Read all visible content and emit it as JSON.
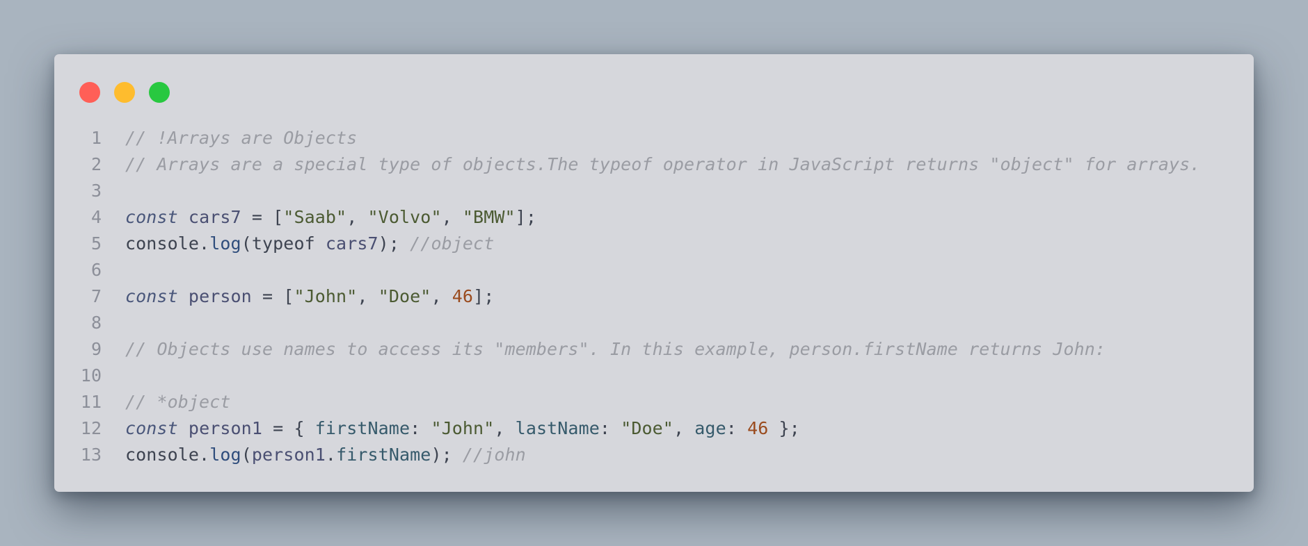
{
  "window": {
    "controls": [
      {
        "name": "close",
        "color": "#ff5f57"
      },
      {
        "name": "minimize",
        "color": "#febc2e"
      },
      {
        "name": "maximize",
        "color": "#28c840"
      }
    ]
  },
  "colors": {
    "background": "#a9b4bf",
    "window": "#d6d7dc",
    "comment": "#9a9ca3",
    "keyword": "#49567a",
    "string": "#4b5a32",
    "number": "#9a4b1e"
  },
  "editor": {
    "lines": [
      {
        "number": "1",
        "tokens": [
          {
            "t": "comment",
            "v": "// !Arrays are Objects"
          }
        ]
      },
      {
        "number": "2",
        "tokens": [
          {
            "t": "comment",
            "v": "// Arrays are a special type of objects.The typeof operator in JavaScript returns \"object\" for arrays."
          }
        ]
      },
      {
        "number": "3",
        "tokens": []
      },
      {
        "number": "4",
        "tokens": [
          {
            "t": "keyword",
            "v": "const"
          },
          {
            "t": "plain",
            "v": " "
          },
          {
            "t": "var",
            "v": "cars7"
          },
          {
            "t": "plain",
            "v": " = ["
          },
          {
            "t": "string",
            "v": "\"Saab\""
          },
          {
            "t": "plain",
            "v": ", "
          },
          {
            "t": "string",
            "v": "\"Volvo\""
          },
          {
            "t": "plain",
            "v": ", "
          },
          {
            "t": "string",
            "v": "\"BMW\""
          },
          {
            "t": "plain",
            "v": "];"
          }
        ]
      },
      {
        "number": "5",
        "tokens": [
          {
            "t": "plain",
            "v": "console."
          },
          {
            "t": "func",
            "v": "log"
          },
          {
            "t": "plain",
            "v": "(typeof "
          },
          {
            "t": "var",
            "v": "cars7"
          },
          {
            "t": "plain",
            "v": "); "
          },
          {
            "t": "comment",
            "v": "//object"
          }
        ]
      },
      {
        "number": "6",
        "tokens": []
      },
      {
        "number": "7",
        "tokens": [
          {
            "t": "keyword",
            "v": "const"
          },
          {
            "t": "plain",
            "v": " "
          },
          {
            "t": "var",
            "v": "person"
          },
          {
            "t": "plain",
            "v": " = ["
          },
          {
            "t": "string",
            "v": "\"John\""
          },
          {
            "t": "plain",
            "v": ", "
          },
          {
            "t": "string",
            "v": "\"Doe\""
          },
          {
            "t": "plain",
            "v": ", "
          },
          {
            "t": "number",
            "v": "46"
          },
          {
            "t": "plain",
            "v": "];"
          }
        ]
      },
      {
        "number": "8",
        "tokens": []
      },
      {
        "number": "9",
        "tokens": [
          {
            "t": "comment",
            "v": "// Objects use names to access its \"members\". In this example, person.firstName returns John:"
          }
        ]
      },
      {
        "number": "10",
        "tokens": []
      },
      {
        "number": "11",
        "tokens": [
          {
            "t": "comment",
            "v": "// *object"
          }
        ]
      },
      {
        "number": "12",
        "tokens": [
          {
            "t": "keyword",
            "v": "const"
          },
          {
            "t": "plain",
            "v": " "
          },
          {
            "t": "var",
            "v": "person1"
          },
          {
            "t": "plain",
            "v": " = { "
          },
          {
            "t": "prop",
            "v": "firstName"
          },
          {
            "t": "plain",
            "v": ": "
          },
          {
            "t": "string",
            "v": "\"John\""
          },
          {
            "t": "plain",
            "v": ", "
          },
          {
            "t": "prop",
            "v": "lastName"
          },
          {
            "t": "plain",
            "v": ": "
          },
          {
            "t": "string",
            "v": "\"Doe\""
          },
          {
            "t": "plain",
            "v": ", "
          },
          {
            "t": "prop",
            "v": "age"
          },
          {
            "t": "plain",
            "v": ": "
          },
          {
            "t": "number",
            "v": "46"
          },
          {
            "t": "plain",
            "v": " };"
          }
        ]
      },
      {
        "number": "13",
        "tokens": [
          {
            "t": "plain",
            "v": "console."
          },
          {
            "t": "func",
            "v": "log"
          },
          {
            "t": "plain",
            "v": "("
          },
          {
            "t": "var",
            "v": "person1"
          },
          {
            "t": "plain",
            "v": "."
          },
          {
            "t": "prop",
            "v": "firstName"
          },
          {
            "t": "plain",
            "v": "); "
          },
          {
            "t": "comment",
            "v": "//john"
          }
        ]
      }
    ]
  }
}
